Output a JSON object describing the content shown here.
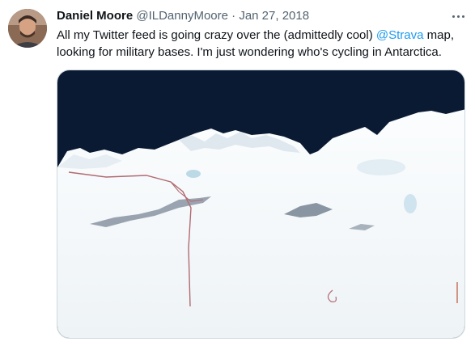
{
  "author": {
    "name": "Daniel Moore",
    "handle": "@ILDannyMoore",
    "separator": "·",
    "date": "Jan 27, 2018"
  },
  "tweet": {
    "text_before": "All my Twitter feed is going crazy over the (admittedly cool) ",
    "mention": "@Strava",
    "text_after": " map, looking for military bases. I'm just wondering who's cycling in Antarctica."
  },
  "icons": {
    "more": "more-horizontal-icon"
  },
  "colors": {
    "text": "#0f1419",
    "secondary": "#536471",
    "link": "#1d9bf0",
    "ocean": "#0b1a33",
    "ice": "#f4f8fb"
  }
}
